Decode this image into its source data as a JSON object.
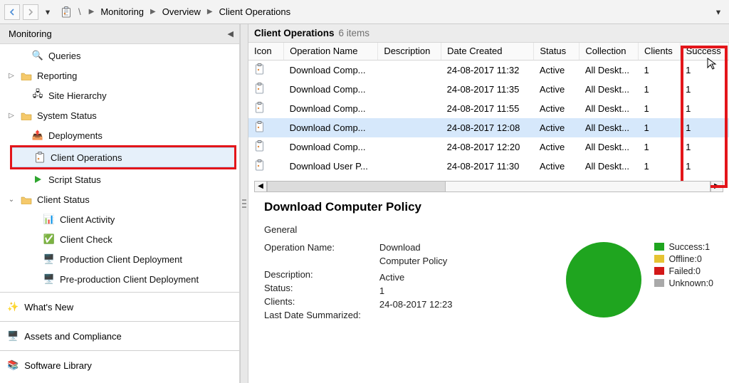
{
  "breadcrumb": {
    "seg1": "Monitoring",
    "seg2": "Overview",
    "seg3": "Client Operations"
  },
  "leftheader": {
    "title": "Monitoring"
  },
  "tree": {
    "queries": "Queries",
    "reporting": "Reporting",
    "site_hierarchy": "Site Hierarchy",
    "system_status": "System Status",
    "deployments": "Deployments",
    "client_operations": "Client Operations",
    "script_status": "Script Status",
    "client_status": "Client Status",
    "client_activity": "Client Activity",
    "client_check": "Client Check",
    "prod_deploy": "Production Client Deployment",
    "preprod_deploy": "Pre-production Client Deployment"
  },
  "bottom_sections": {
    "whats_new": "What's New",
    "assets": "Assets and Compliance",
    "library": "Software Library"
  },
  "content_header": {
    "title": "Client Operations",
    "count": "6 items"
  },
  "columns": {
    "icon": "Icon",
    "op": "Operation Name",
    "desc": "Description",
    "date": "Date Created",
    "status": "Status",
    "coll": "Collection",
    "clients": "Clients",
    "success": "Success"
  },
  "rows": [
    {
      "op": "Download Comp...",
      "desc": "",
      "date": "24-08-2017 11:32",
      "status": "Active",
      "coll": "All Deskt...",
      "clients": "1",
      "success": "1"
    },
    {
      "op": "Download Comp...",
      "desc": "",
      "date": "24-08-2017 11:35",
      "status": "Active",
      "coll": "All Deskt...",
      "clients": "1",
      "success": "1"
    },
    {
      "op": "Download Comp...",
      "desc": "",
      "date": "24-08-2017 11:55",
      "status": "Active",
      "coll": "All Deskt...",
      "clients": "1",
      "success": "1"
    },
    {
      "op": "Download Comp...",
      "desc": "",
      "date": "24-08-2017 12:08",
      "status": "Active",
      "coll": "All Deskt...",
      "clients": "1",
      "success": "1"
    },
    {
      "op": "Download Comp...",
      "desc": "",
      "date": "24-08-2017 12:20",
      "status": "Active",
      "coll": "All Deskt...",
      "clients": "1",
      "success": "1"
    },
    {
      "op": "Download User P...",
      "desc": "",
      "date": "24-08-2017 11:30",
      "status": "Active",
      "coll": "All Deskt...",
      "clients": "1",
      "success": "1"
    }
  ],
  "detail": {
    "title": "Download Computer Policy",
    "general": "General",
    "k_op": "Operation Name:",
    "v_op_l1": "Download",
    "v_op_l2": "Computer Policy",
    "k_desc": "Description:",
    "v_desc": "",
    "k_status": "Status:",
    "v_status": "Active",
    "k_clients": "Clients:",
    "v_clients": "1",
    "k_last": "Last Date Summarized:",
    "v_last": "24-08-2017 12:23"
  },
  "legend": {
    "success": "Success:1",
    "offline": "Offline:0",
    "failed": "Failed:0",
    "unknown": "Unknown:0",
    "c_success": "#1fa51f",
    "c_offline": "#e6c333",
    "c_failed": "#d31818",
    "c_unknown": "#a9a9a9"
  },
  "chart_data": {
    "type": "pie",
    "title": "",
    "series": [
      {
        "name": "status",
        "values": [
          1,
          0,
          0,
          0
        ]
      }
    ],
    "categories": [
      "Success",
      "Offline",
      "Failed",
      "Unknown"
    ],
    "colors": [
      "#1fa51f",
      "#e6c333",
      "#d31818",
      "#a9a9a9"
    ]
  }
}
